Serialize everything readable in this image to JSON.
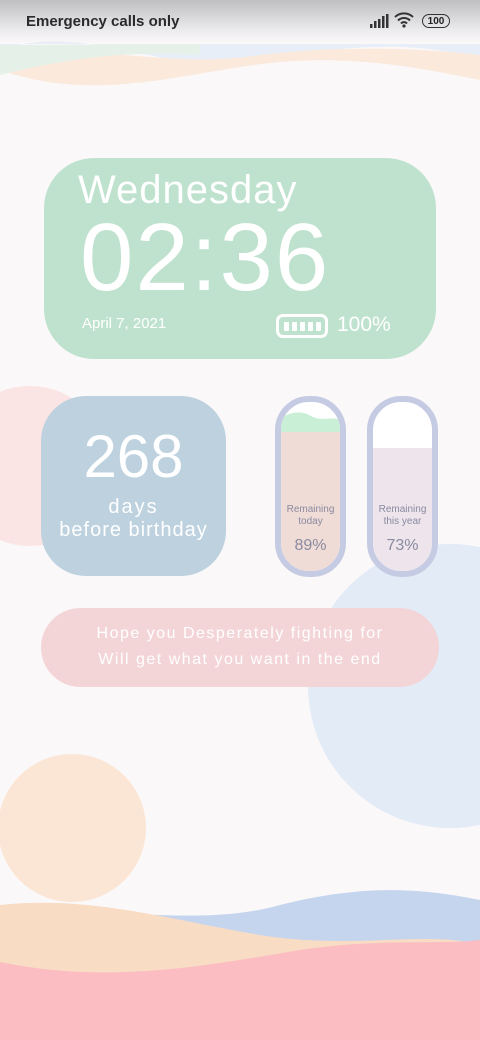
{
  "status_bar": {
    "carrier": "Emergency calls only",
    "battery_level": "100",
    "icons": [
      "signal-icon",
      "wifi-icon",
      "battery-icon"
    ]
  },
  "clock_widget": {
    "weekday": "Wednesday",
    "time": "02:36",
    "date": "April 7, 2021",
    "battery_percent": "100%",
    "color": "#bfe2cf"
  },
  "birthday_widget": {
    "days": "268",
    "unit": "days",
    "label": "before birthday",
    "color": "#bdd1df"
  },
  "progress_widgets": [
    {
      "label_line1": "Remaining",
      "label_line2": "today",
      "value": "89%",
      "fraction": 0.89,
      "fill_color": "#f0dcd6"
    },
    {
      "label_line1": "Remaining",
      "label_line2": "this year",
      "value": "73%",
      "fraction": 0.73,
      "fill_color": "#ede4ec"
    }
  ],
  "quote": {
    "line1": "Hope you Desperately fighting for",
    "line2": "Will get what you want in the end",
    "color": "#f3d5d8"
  }
}
